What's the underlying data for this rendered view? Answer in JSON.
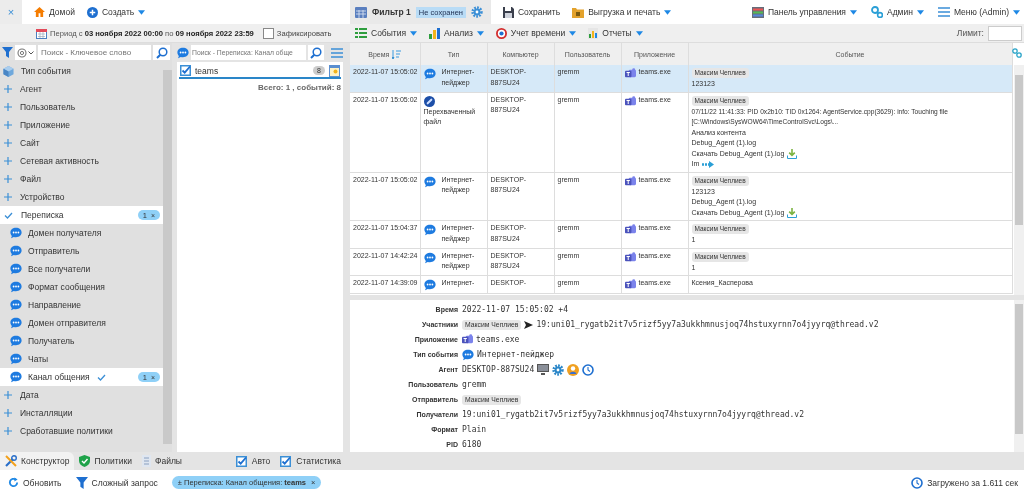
{
  "header": {
    "close": "×",
    "nav": [
      {
        "kind": "home",
        "label": "Домой",
        "dropdown": false
      },
      {
        "kind": "create",
        "label": "Создать",
        "dropdown": true
      }
    ],
    "filter_tab": {
      "label": "Фильтр 1",
      "badge": "Не сохранен"
    },
    "actions": [
      {
        "kind": "save",
        "label": "Сохранить",
        "dropdown": false
      },
      {
        "kind": "export",
        "label": "Выгрузка и печать",
        "dropdown": true
      }
    ],
    "right_menu": [
      {
        "kind": "dashboard",
        "label": "Панель управления",
        "dropdown": true
      },
      {
        "kind": "admin",
        "label": "Админ",
        "dropdown": true
      },
      {
        "kind": "menu",
        "label": "Меню (Admin)",
        "dropdown": true
      }
    ]
  },
  "period_bar": {
    "period": "Период с **03 ноября 2022 00:00** по **09 ноября 2022 23:59**",
    "fix": {
      "label": "Зафиксировать",
      "checked": false
    },
    "menus": [
      {
        "kind": "events",
        "label": "События"
      },
      {
        "kind": "analysis",
        "label": "Анализ"
      },
      {
        "kind": "time",
        "label": "Учет времени"
      },
      {
        "kind": "reports",
        "label": "Отчеты"
      }
    ],
    "limit": {
      "label": "Лимит:"
    }
  },
  "filter_sidebar": {
    "search": {
      "placeholder": "Поиск - Ключевое слово"
    },
    "items": [
      {
        "kind": "root",
        "label": "Тип события",
        "selected": false
      },
      {
        "kind": "group",
        "label": "Агент",
        "expanded": false,
        "selected": false
      },
      {
        "kind": "group",
        "label": "Пользователь",
        "expanded": false,
        "selected": false
      },
      {
        "kind": "group",
        "label": "Приложение",
        "expanded": false,
        "selected": false
      },
      {
        "kind": "group",
        "label": "Сайт",
        "expanded": false,
        "selected": false
      },
      {
        "kind": "group",
        "label": "Сетевая активность",
        "expanded": false,
        "selected": false
      },
      {
        "kind": "group",
        "label": "Файл",
        "expanded": false,
        "selected": false
      },
      {
        "kind": "group",
        "label": "Устройство",
        "expanded": false,
        "selected": false
      },
      {
        "kind": "group",
        "label": "Переписка",
        "expanded": true,
        "selected": true,
        "badge": "1",
        "remove": "×",
        "children": [
          {
            "label": "Домен получателя",
            "selected": false,
            "filtered": false
          },
          {
            "label": "Отправитель",
            "selected": false,
            "filtered": false
          },
          {
            "label": "Все получатели",
            "selected": false,
            "filtered": false
          },
          {
            "label": "Формат сообщения",
            "selected": false,
            "filtered": false
          },
          {
            "label": "Направление",
            "selected": false,
            "filtered": false
          },
          {
            "label": "Домен отправителя",
            "selected": false,
            "filtered": false
          },
          {
            "label": "Получатель",
            "selected": false,
            "filtered": false
          },
          {
            "label": "Чаты",
            "selected": false,
            "filtered": false
          },
          {
            "label": "Канал общения",
            "selected": true,
            "filtered": true,
            "badge": "1",
            "remove": "×"
          }
        ]
      },
      {
        "kind": "group",
        "label": "Дата",
        "expanded": false,
        "selected": false
      },
      {
        "kind": "group",
        "label": "Инсталляции",
        "expanded": false,
        "selected": false
      },
      {
        "kind": "group",
        "label": "Сработавшие политики",
        "expanded": false,
        "selected": false
      }
    ]
  },
  "values_panel": {
    "search": {
      "placeholder": "Поиск - Переписка: Канал обще"
    },
    "values": [
      {
        "label": "teams",
        "checked": true,
        "count": "8"
      }
    ],
    "total": "Всего: 1 , событий: 8"
  },
  "events_table": {
    "columns": [
      {
        "label": "Время",
        "sorted": true
      },
      {
        "label": "Тип",
        "sorted": false
      },
      {
        "label": "Компьютер",
        "sorted": false
      },
      {
        "label": "Пользователь",
        "sorted": false
      },
      {
        "label": "Приложение",
        "sorted": false
      },
      {
        "label": "Событие",
        "sorted": false
      }
    ],
    "rows": [
      {
        "selected": true,
        "time": "2022-11-07 15:05:02",
        "type": {
          "kind": "pager",
          "label": "Интернет-пейджер"
        },
        "computer": "DESKTOP-887SU24",
        "user": "gremm",
        "app": "teams.exe",
        "event": {
          "sender": "Максим Чеплиев",
          "lines": [
            {
              "kind": "text",
              "text": "123123"
            }
          ]
        }
      },
      {
        "selected": false,
        "time": "2022-11-07 15:05:02",
        "type": {
          "kind": "file",
          "label": "Перехваченный файл"
        },
        "computer": "DESKTOP-887SU24",
        "user": "gremm",
        "app": "teams.exe",
        "event": {
          "sender": "Максим Чеплиев",
          "lines": [
            {
              "kind": "text",
              "text": "07/11/22 11:41:33: PID 0x2b10: TID 0x1264: AgentService.cpp(3629): info: Touching file [C:\\Windows\\SysWOW64\\TimeControlSvc\\Logs\\..."
            },
            {
              "kind": "text",
              "text": "Анализ контента"
            },
            {
              "kind": "text",
              "text": "Debug_Agent (1).log"
            },
            {
              "kind": "download",
              "text": "Скачать Debug_Agent (1).log"
            },
            {
              "kind": "link",
              "text": "Im"
            }
          ]
        }
      },
      {
        "selected": false,
        "time": "2022-11-07 15:05:02",
        "type": {
          "kind": "pager",
          "label": "Интернет-пейджер"
        },
        "computer": "DESKTOP-887SU24",
        "user": "gremm",
        "app": "teams.exe",
        "event": {
          "sender": "Максим Чеплиев",
          "lines": [
            {
              "kind": "text",
              "text": "123123"
            },
            {
              "kind": "text",
              "text": "Debug_Agent (1).log"
            },
            {
              "kind": "download",
              "text": "Скачать Debug_Agent (1).log"
            }
          ]
        }
      },
      {
        "selected": false,
        "time": "2022-11-07 15:04:37",
        "type": {
          "kind": "pager",
          "label": "Интернет-пейджер"
        },
        "computer": "DESKTOP-887SU24",
        "user": "gremm",
        "app": "teams.exe",
        "event": {
          "sender": "Максим Чеплиев",
          "lines": [
            {
              "kind": "text",
              "text": "1"
            }
          ]
        }
      },
      {
        "selected": false,
        "time": "2022-11-07 14:42:24",
        "type": {
          "kind": "pager",
          "label": "Интернет-пейджер"
        },
        "computer": "DESKTOP-887SU24",
        "user": "gremm",
        "app": "teams.exe",
        "event": {
          "sender": "Максим Чеплиев",
          "lines": [
            {
              "kind": "text",
              "text": "1"
            }
          ]
        }
      },
      {
        "selected": false,
        "time": "2022-11-07 14:39:09",
        "type": {
          "kind": "pager",
          "label": "Интернет-"
        },
        "computer": "DESKTOP-",
        "user": "gremm",
        "app": "teams.exe",
        "event": {
          "lines": [
            {
              "kind": "text",
              "text": "Ксения_Касперова"
            }
          ]
        }
      }
    ]
  },
  "event_detail": {
    "fields": [
      {
        "kind": "text",
        "label": "Время",
        "value": "2022-11-07 15:05:02 +4"
      },
      {
        "kind": "participants",
        "label": "Участники",
        "chip": "Максим Чеплиев",
        "value": "19:uni01_rygatb2it7v5rizf5yy7a3ukkhmnusjoq74hstuxyrnn7o4jyyrq@thread.v2"
      },
      {
        "kind": "app",
        "label": "Приложение",
        "value": "teams.exe"
      },
      {
        "kind": "event_type",
        "label": "Тип события",
        "value": "Интернет-пейджер"
      },
      {
        "kind": "agent",
        "label": "Агент",
        "value": "DESKTOP-887SU24"
      },
      {
        "kind": "text",
        "label": "Пользователь",
        "value": "gremm"
      },
      {
        "kind": "chip",
        "label": "Отправитель",
        "value": "Максим Чеплиев"
      },
      {
        "kind": "text",
        "label": "Получатели",
        "value": "19:uni01_rygatb2it7v5rizf5yy7a3ukkhmnusjoq74hstuxyrnn7o4jyyrq@thread.v2"
      },
      {
        "kind": "text",
        "label": "Формат",
        "value": "Plain"
      },
      {
        "kind": "text",
        "label": "PID",
        "value": "6180"
      }
    ]
  },
  "bottom_tabs": {
    "tabs": [
      {
        "kind": "constructor",
        "label": "Конструктор",
        "selected": true
      },
      {
        "kind": "policies",
        "label": "Политики",
        "selected": false
      },
      {
        "kind": "files",
        "label": "Файлы",
        "selected": false
      }
    ],
    "toggles": [
      {
        "label": "Авто",
        "checked": true
      },
      {
        "label": "Статистика",
        "checked": true
      }
    ]
  },
  "status_bar": {
    "actions": [
      {
        "kind": "refresh",
        "label": "Обновить"
      },
      {
        "kind": "query",
        "label": "Сложный запрос"
      }
    ],
    "filter_chip": {
      "text": "± Переписка: Канал общения: **teams**",
      "remove": "×"
    },
    "loaded": "Загружено за 1.611 сек"
  }
}
